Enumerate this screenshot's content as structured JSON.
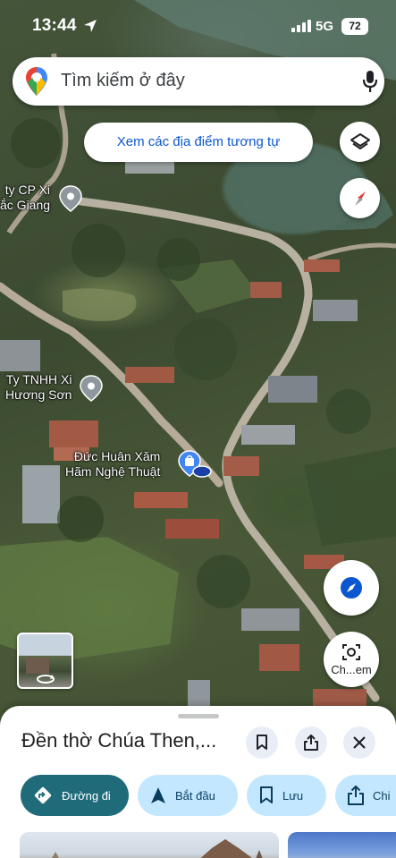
{
  "status_bar": {
    "time": "13:44",
    "network": "5G",
    "battery": "72"
  },
  "search": {
    "placeholder": "Tìm kiếm ở đây"
  },
  "similar_places_chip": "Xem các địa điểm tương tự",
  "map_labels": [
    {
      "id": "company-cp-xi",
      "lines": [
        "ty CP Xi",
        "ắc Giang"
      ]
    },
    {
      "id": "company-tnhh-xi",
      "lines": [
        "Ty TNHH Xi",
        "Hương Sơn"
      ]
    },
    {
      "id": "tattoo-shop",
      "lines": [
        "Đức Huân Xăm",
        "Hãm Nghệ Thuật"
      ]
    }
  ],
  "screenshot_button_label": "Ch...em",
  "place": {
    "title": "Đền thờ Chúa Then,..."
  },
  "actions": [
    {
      "label": "Đường đi",
      "icon": "directions-icon"
    },
    {
      "label": "Bắt đầu",
      "icon": "navigation-arrow-icon"
    },
    {
      "label": "Lưu",
      "icon": "bookmark-icon"
    },
    {
      "label": "Chi",
      "icon": "share-icon"
    }
  ],
  "colors": {
    "accent": "#0b57d0",
    "primary_action": "#1f6b7a",
    "chip_bg": "#c2e7ff"
  }
}
